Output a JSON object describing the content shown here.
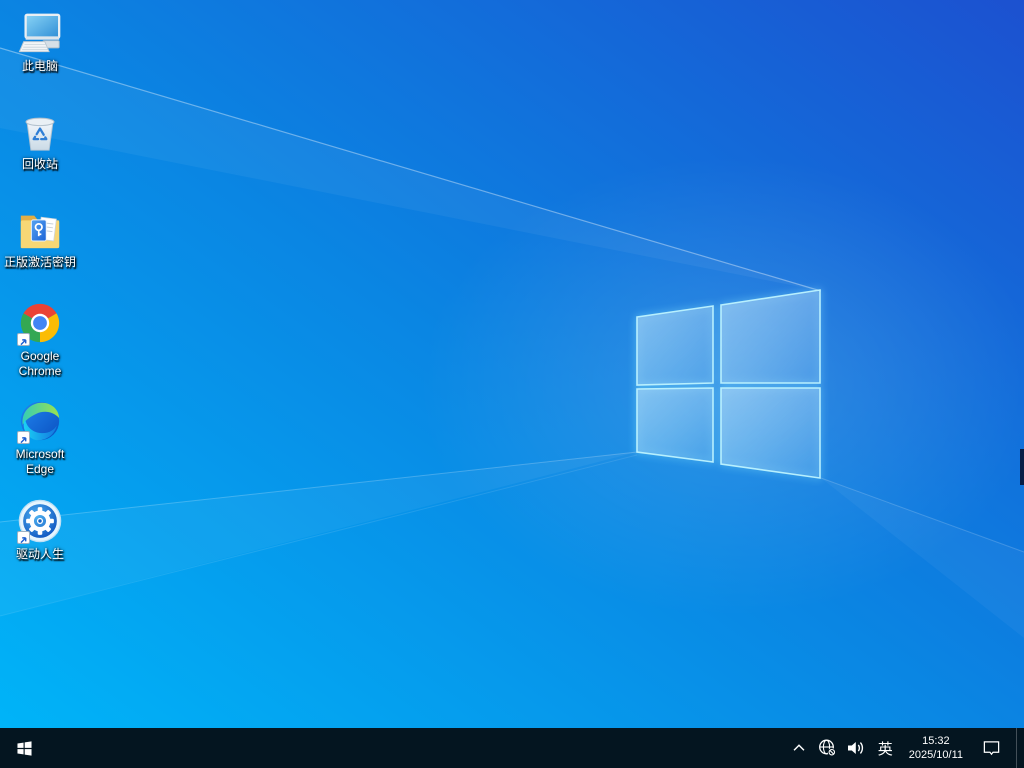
{
  "wallpaper": {
    "gradient_bottom_left": "#00b4f8",
    "gradient_mid": "#0a86e3",
    "gradient_top_right": "#1c51d0",
    "logo_glow_color": "#8deaff"
  },
  "desktop": {
    "icons": [
      {
        "label": "此电脑",
        "icon": "this-pc",
        "shortcut": false
      },
      {
        "label": "回收站",
        "icon": "recycle-bin",
        "shortcut": false
      },
      {
        "label": "正版激活密钥",
        "icon": "activation-key-folder",
        "shortcut": false
      },
      {
        "label": "Google Chrome",
        "icon": "chrome",
        "shortcut": true
      },
      {
        "label": "Microsoft Edge",
        "icon": "edge",
        "shortcut": true
      },
      {
        "label": "驱动人生",
        "icon": "driver-life",
        "shortcut": true
      }
    ]
  },
  "taskbar": {
    "background": "#041520",
    "ime_indicator": "英",
    "clock": {
      "time": "15:32",
      "date": "2025/10/11"
    },
    "tray": [
      "hidden-icons-chevron",
      "network-offline",
      "volume",
      "ime",
      "clock",
      "action-center",
      "show-desktop"
    ]
  }
}
